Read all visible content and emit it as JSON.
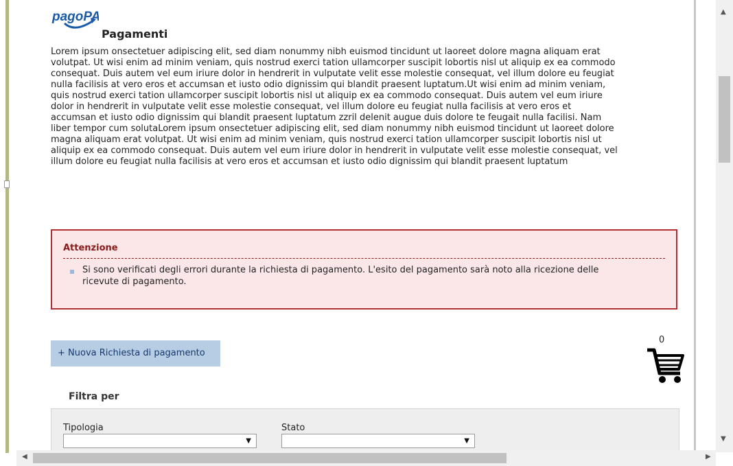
{
  "page": {
    "logo_text": "pagoPA",
    "title": "Pagamenti",
    "intro": "Lorem ipsum onsectetuer adipiscing elit, sed diam nonummy nibh euismod tincidunt ut laoreet dolore magna aliquam erat\nvolutpat. Ut wisi enim ad minim veniam, quis nostrud exerci tation ullamcorper suscipit lobortis nisl ut aliquip ex ea commodo\nconsequat. Duis autem vel eum iriure dolor in hendrerit in vulputate velit esse molestie consequat, vel illum dolore eu feugiat\nnulla facilisis at vero eros et accumsan et iusto odio dignissim qui blandit praesent luptatum.Ut wisi enim ad minim veniam,\nquis nostrud exerci tation ullamcorper suscipit lobortis nisl ut aliquip ex ea commodo consequat. Duis autem vel eum iriure\ndolor in hendrerit in vulputate velit esse molestie consequat, vel illum dolore eu feugiat nulla facilisis at vero eros et\naccumsan et iusto odio dignissim qui blandit praesent luptatum zzril delenit augue duis dolore te feugait nulla facilisi. Nam\nliber tempor cum solutaLorem ipsum onsectetuer adipiscing elit, sed diam nonummy nibh euismod tincidunt ut laoreet dolore\nmagna aliquam erat volutpat. Ut wisi enim ad minim veniam, quis nostrud exerci tation ullamcorper suscipit lobortis nisl ut\naliquip ex ea commodo consequat. Duis autem vel eum iriure dolor in hendrerit in vulputate velit esse molestie consequat, vel\nillum dolore eu feugiat nulla facilisis at vero eros et accumsan et iusto odio dignissim qui blandit praesent luptatum"
  },
  "alert": {
    "title": "Attenzione",
    "message": "Si sono verificati degli errori durante la richiesta di pagamento. L'esito del pagamento sarà noto alla ricezione delle\nricevute di pagamento."
  },
  "actions": {
    "new_request_label": "+ Nuova Richiesta di pagamento"
  },
  "cart": {
    "count": "0",
    "icon": "cart-icon"
  },
  "filter": {
    "title": "Filtra per",
    "tipologia_label": "Tipologia",
    "tipologia_value": "",
    "stato_label": "Stato",
    "stato_value": ""
  },
  "colors": {
    "alert_border": "#b12f30",
    "alert_bg": "#fbe7e7",
    "button_bg": "#b6cde4",
    "logo_blue": "#1b5aa6"
  }
}
